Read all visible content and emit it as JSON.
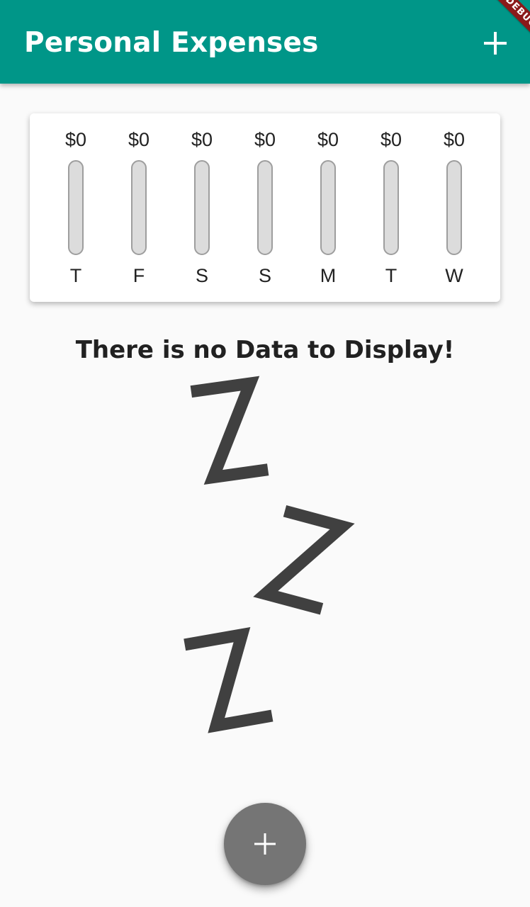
{
  "app_bar": {
    "title": "Personal Expenses",
    "add_icon": "plus-icon",
    "background_color": "#009688"
  },
  "debug_banner": {
    "label": "DEBUG"
  },
  "chart": {
    "bars": [
      {
        "day": "T",
        "amount_label": "$0",
        "fill_fraction": 0
      },
      {
        "day": "F",
        "amount_label": "$0",
        "fill_fraction": 0
      },
      {
        "day": "S",
        "amount_label": "$0",
        "fill_fraction": 0
      },
      {
        "day": "S",
        "amount_label": "$0",
        "fill_fraction": 0
      },
      {
        "day": "M",
        "amount_label": "$0",
        "fill_fraction": 0
      },
      {
        "day": "T",
        "amount_label": "$0",
        "fill_fraction": 0
      },
      {
        "day": "W",
        "amount_label": "$0",
        "fill_fraction": 0
      }
    ]
  },
  "empty_state": {
    "message": "There is no Data to Display!",
    "image_icon": "sleeping-zzz-icon"
  },
  "fab": {
    "icon": "plus-icon",
    "color": "#757575"
  }
}
